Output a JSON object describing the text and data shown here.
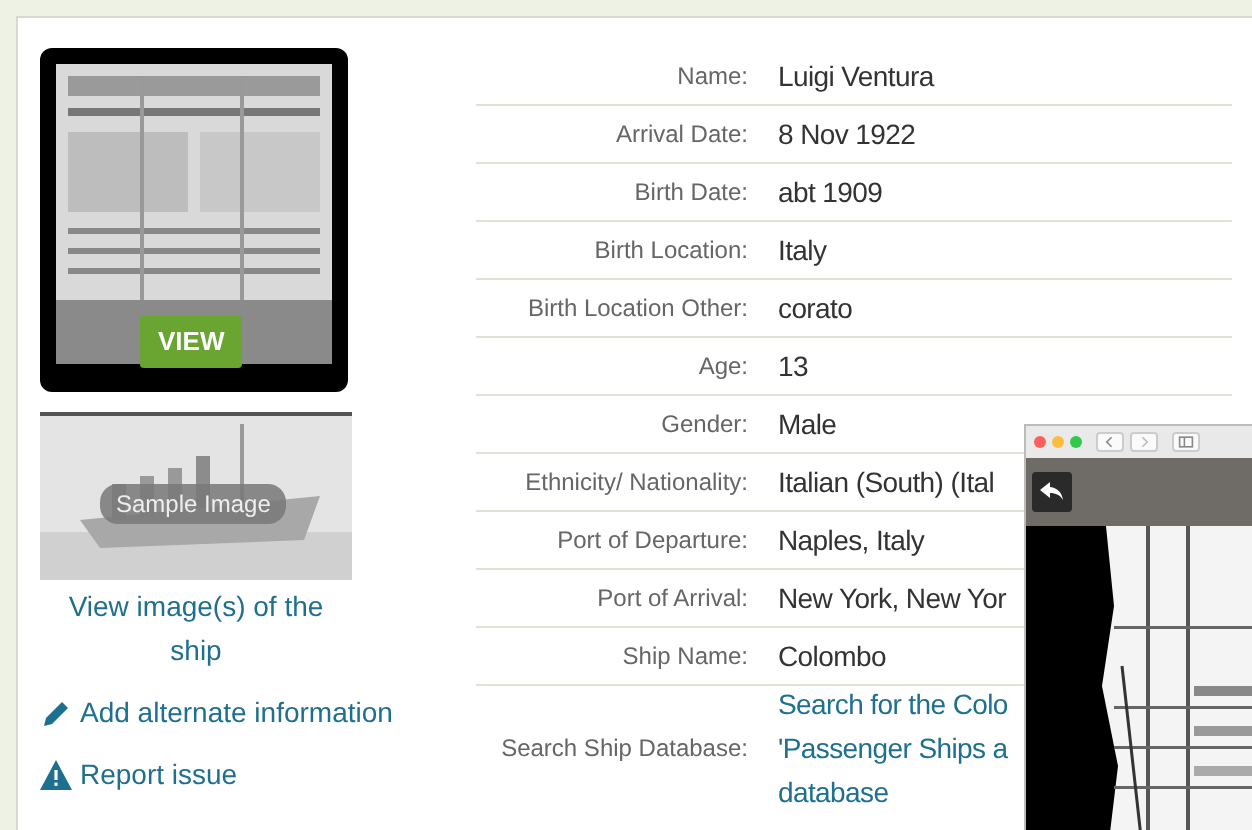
{
  "record_image": {
    "button": "VIEW"
  },
  "ship_image": {
    "caption": "Sample Image"
  },
  "links": [
    {
      "kind": "ship",
      "text": "View image(s) of the ship"
    },
    {
      "kind": "edit",
      "text": "Add alternate information"
    },
    {
      "kind": "report",
      "text": "Report issue"
    }
  ],
  "fields": [
    {
      "label": "Name:",
      "value": "Luigi Ventura"
    },
    {
      "label": "Arrival Date:",
      "value": "8 Nov 1922"
    },
    {
      "label": "Birth Date:",
      "value": "abt 1909"
    },
    {
      "label": "Birth Location:",
      "value": "Italy"
    },
    {
      "label": "Birth Location Other:",
      "value": "corato"
    },
    {
      "label": "Age:",
      "value": "13"
    },
    {
      "label": "Gender:",
      "value": "Male"
    },
    {
      "label": "Ethnicity/ Nationality:",
      "value": "Italian (South) (Ital"
    },
    {
      "label": "Port of Departure:",
      "value": "Naples, Italy"
    },
    {
      "label": "Port of Arrival:",
      "value": "New York, New Yor"
    },
    {
      "label": "Ship Name:",
      "value": "Colombo"
    },
    {
      "label": "Search Ship Database:",
      "link_lines": [
        "Search for the Colo",
        "'Passenger Ships a",
        "database"
      ]
    }
  ]
}
